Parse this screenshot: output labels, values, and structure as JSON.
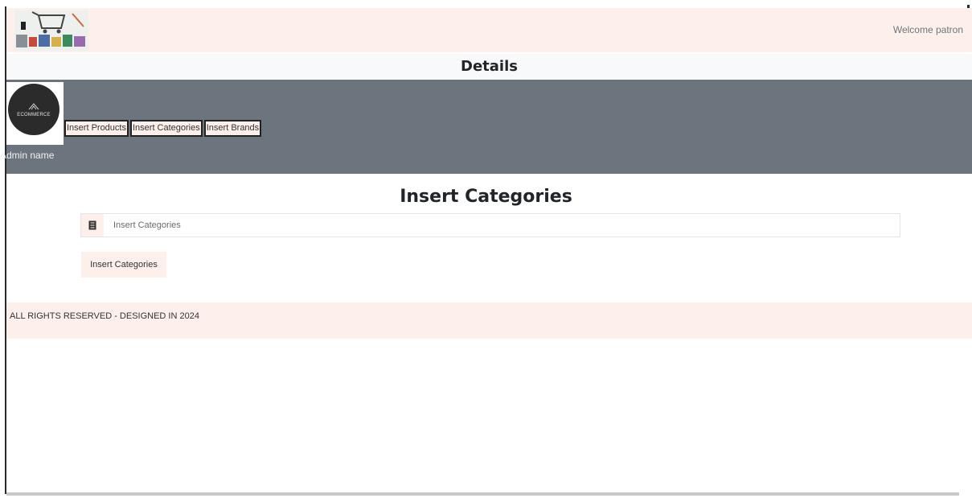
{
  "header": {
    "welcome_text": "Welcome patron",
    "logo_icon": "shopping-cart-collage-icon"
  },
  "details_bar": {
    "title": "Details"
  },
  "admin": {
    "logo_text": "ECOMMERCE",
    "name": "Admin name",
    "nav": [
      {
        "label": "Insert Products"
      },
      {
        "label": "Insert Categories"
      },
      {
        "label": "Insert Brands"
      }
    ]
  },
  "form": {
    "title": "Insert Categories",
    "input_placeholder": "Insert Categories",
    "input_value": "",
    "addon_icon": "receipt-icon",
    "submit_label": "Insert Categories"
  },
  "footer": {
    "text": "ALL RIGHTS RESERVED - DESIGNED IN 2024"
  },
  "colors": {
    "accent_bg": "#fdf0ea",
    "admin_bar": "#6c757d",
    "light_bar": "#f8f9fa"
  }
}
